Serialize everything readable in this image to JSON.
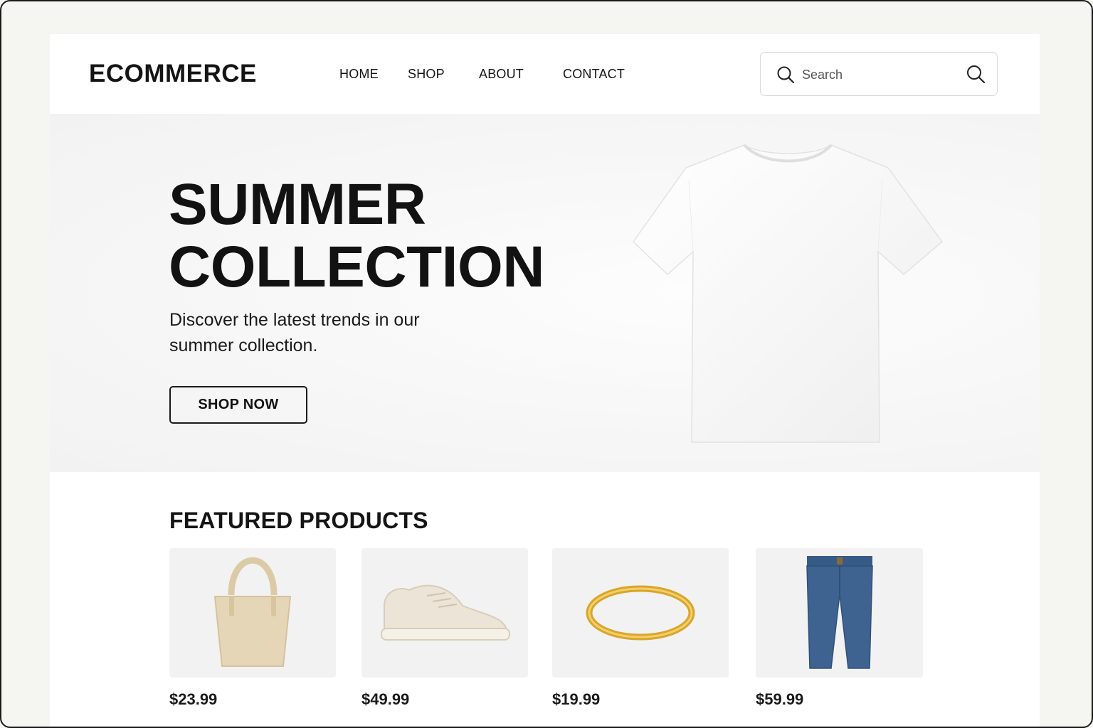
{
  "header": {
    "logo": "ECOMMERCE",
    "nav": [
      {
        "label": "HOME"
      },
      {
        "label": "SHOP"
      },
      {
        "label": "ABOUT"
      },
      {
        "label": "CONTACT"
      }
    ],
    "search": {
      "placeholder": "Search",
      "value": "",
      "lead_icon": "search-icon",
      "submit_icon": "search-icon"
    }
  },
  "hero": {
    "title_line1": "SUMMER",
    "title_line2": "COLLECTION",
    "subtitle": "Discover the latest trends in our summer collection.",
    "cta_label": "SHOP NOW",
    "image": "white-tshirt"
  },
  "featured": {
    "title": "FEATURED PRODUCTS",
    "products": [
      {
        "image": "tote-bag",
        "price": "$23.99"
      },
      {
        "image": "sneaker",
        "price": "$49.99"
      },
      {
        "image": "gold-ring",
        "price": "$19.99"
      },
      {
        "image": "denim-jeans",
        "price": "$59.99"
      }
    ]
  },
  "colors": {
    "text": "#111111",
    "hero_bg": "#f6f6f6",
    "card_bg": "#f2f2f2",
    "page_bg": "#f5f5f2",
    "jeans": "#3f6391",
    "ring": "#d9a52a",
    "tote": "#e6d6b8"
  }
}
